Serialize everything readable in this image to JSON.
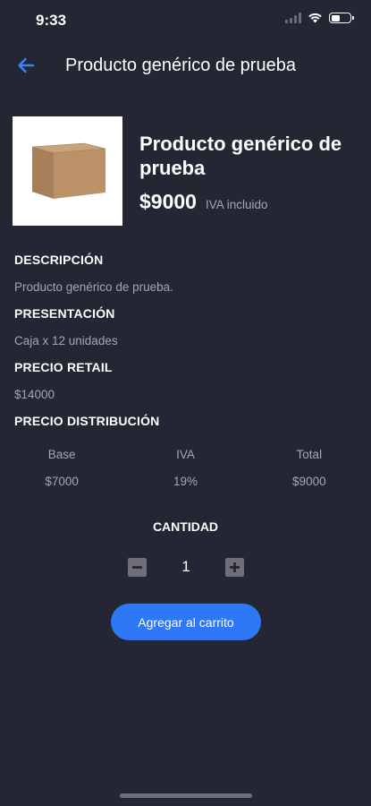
{
  "status_bar": {
    "time": "9:33"
  },
  "nav": {
    "title": "Producto genérico de prueba"
  },
  "product": {
    "name": "Producto genérico de prueba",
    "price": "$9000",
    "price_note": "IVA incluido"
  },
  "sections": {
    "description": {
      "title": "DESCRIPCIÓN",
      "text": "Producto genérico de prueba."
    },
    "presentation": {
      "title": "PRESENTACIÓN",
      "text": "Caja x 12 unidades"
    },
    "retail": {
      "title": "PRECIO RETAIL",
      "text": "$14000"
    },
    "distribution": {
      "title": "PRECIO DISTRIBUCIÓN",
      "headers": [
        "Base",
        "IVA",
        "Total"
      ],
      "values": [
        "$7000",
        "19%",
        "$9000"
      ]
    }
  },
  "quantity": {
    "title": "CANTIDAD",
    "value": "1",
    "minus_icon": "minus-icon",
    "plus_icon": "plus-icon"
  },
  "cart_button": {
    "label": "Agregar al carrito"
  },
  "colors": {
    "background": "#252634",
    "accent": "#2d78f6",
    "muted_text": "#a5a6b0"
  }
}
